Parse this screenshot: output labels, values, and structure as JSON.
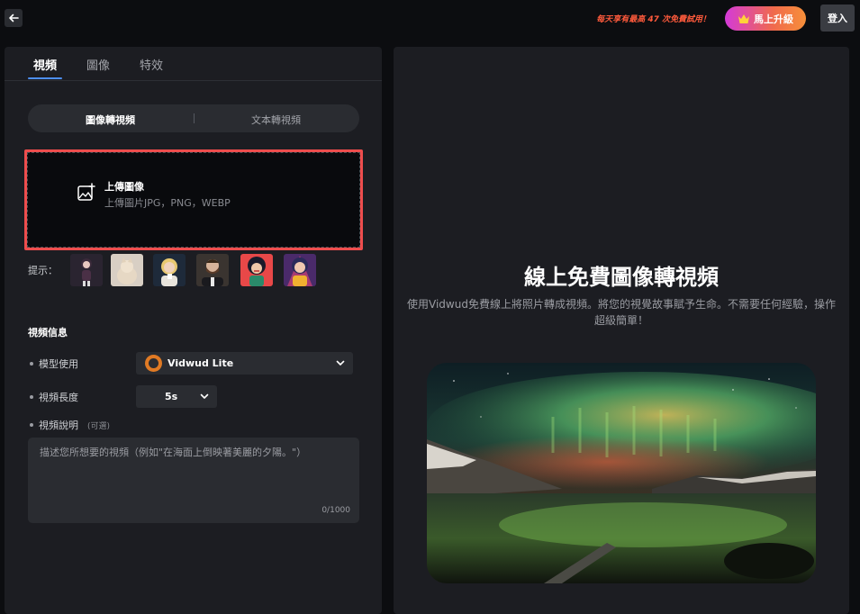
{
  "topbar": {
    "back_icon": "arrow-left-icon",
    "promo_text": "每天享有最高 47 次免費試用！",
    "upgrade_label": "馬上升級",
    "upgrade_icon": "crown-icon",
    "login_label": "登入"
  },
  "tabs": [
    {
      "label": "視頻",
      "active": true
    },
    {
      "label": "圖像",
      "active": false
    },
    {
      "label": "特效",
      "active": false
    }
  ],
  "mode_switch": {
    "options": [
      "圖像轉視頻",
      "文本轉視頻"
    ],
    "selected": "圖像轉視頻"
  },
  "upload": {
    "icon": "image-add-icon",
    "title": "上傳圖像",
    "subtitle": "上傳圖片JPG，PNG，WEBP"
  },
  "hints": {
    "label": "提示：",
    "thumbnails": [
      "girl-anime",
      "cat-photo",
      "woman-coffee",
      "bearded-man",
      "pop-art-woman",
      "colorful-girl"
    ]
  },
  "video_info": {
    "title": "視頻信息",
    "model_label": "模型使用",
    "model_value": "Vidwud Lite",
    "length_label": "視頻長度",
    "length_value": "5s",
    "desc_label": "視頻說明",
    "desc_optional": "(可選)",
    "desc_placeholder": "描述您所想要的視頻（例如\"在海面上倒映著美麗的夕陽。\"）",
    "desc_count": "0/1000"
  },
  "hero": {
    "title": "線上免費圖像轉視頻",
    "description": "使用Vidwud免費線上將照片轉成視頻。將您的視覺故事賦予生命。不需要任何經驗，操作超級簡單！",
    "image": "aurora-landscape"
  },
  "colors": {
    "accent": "#4d8ff5",
    "upload_border": "#ee4d4d",
    "promo": "#ff5a3c"
  }
}
